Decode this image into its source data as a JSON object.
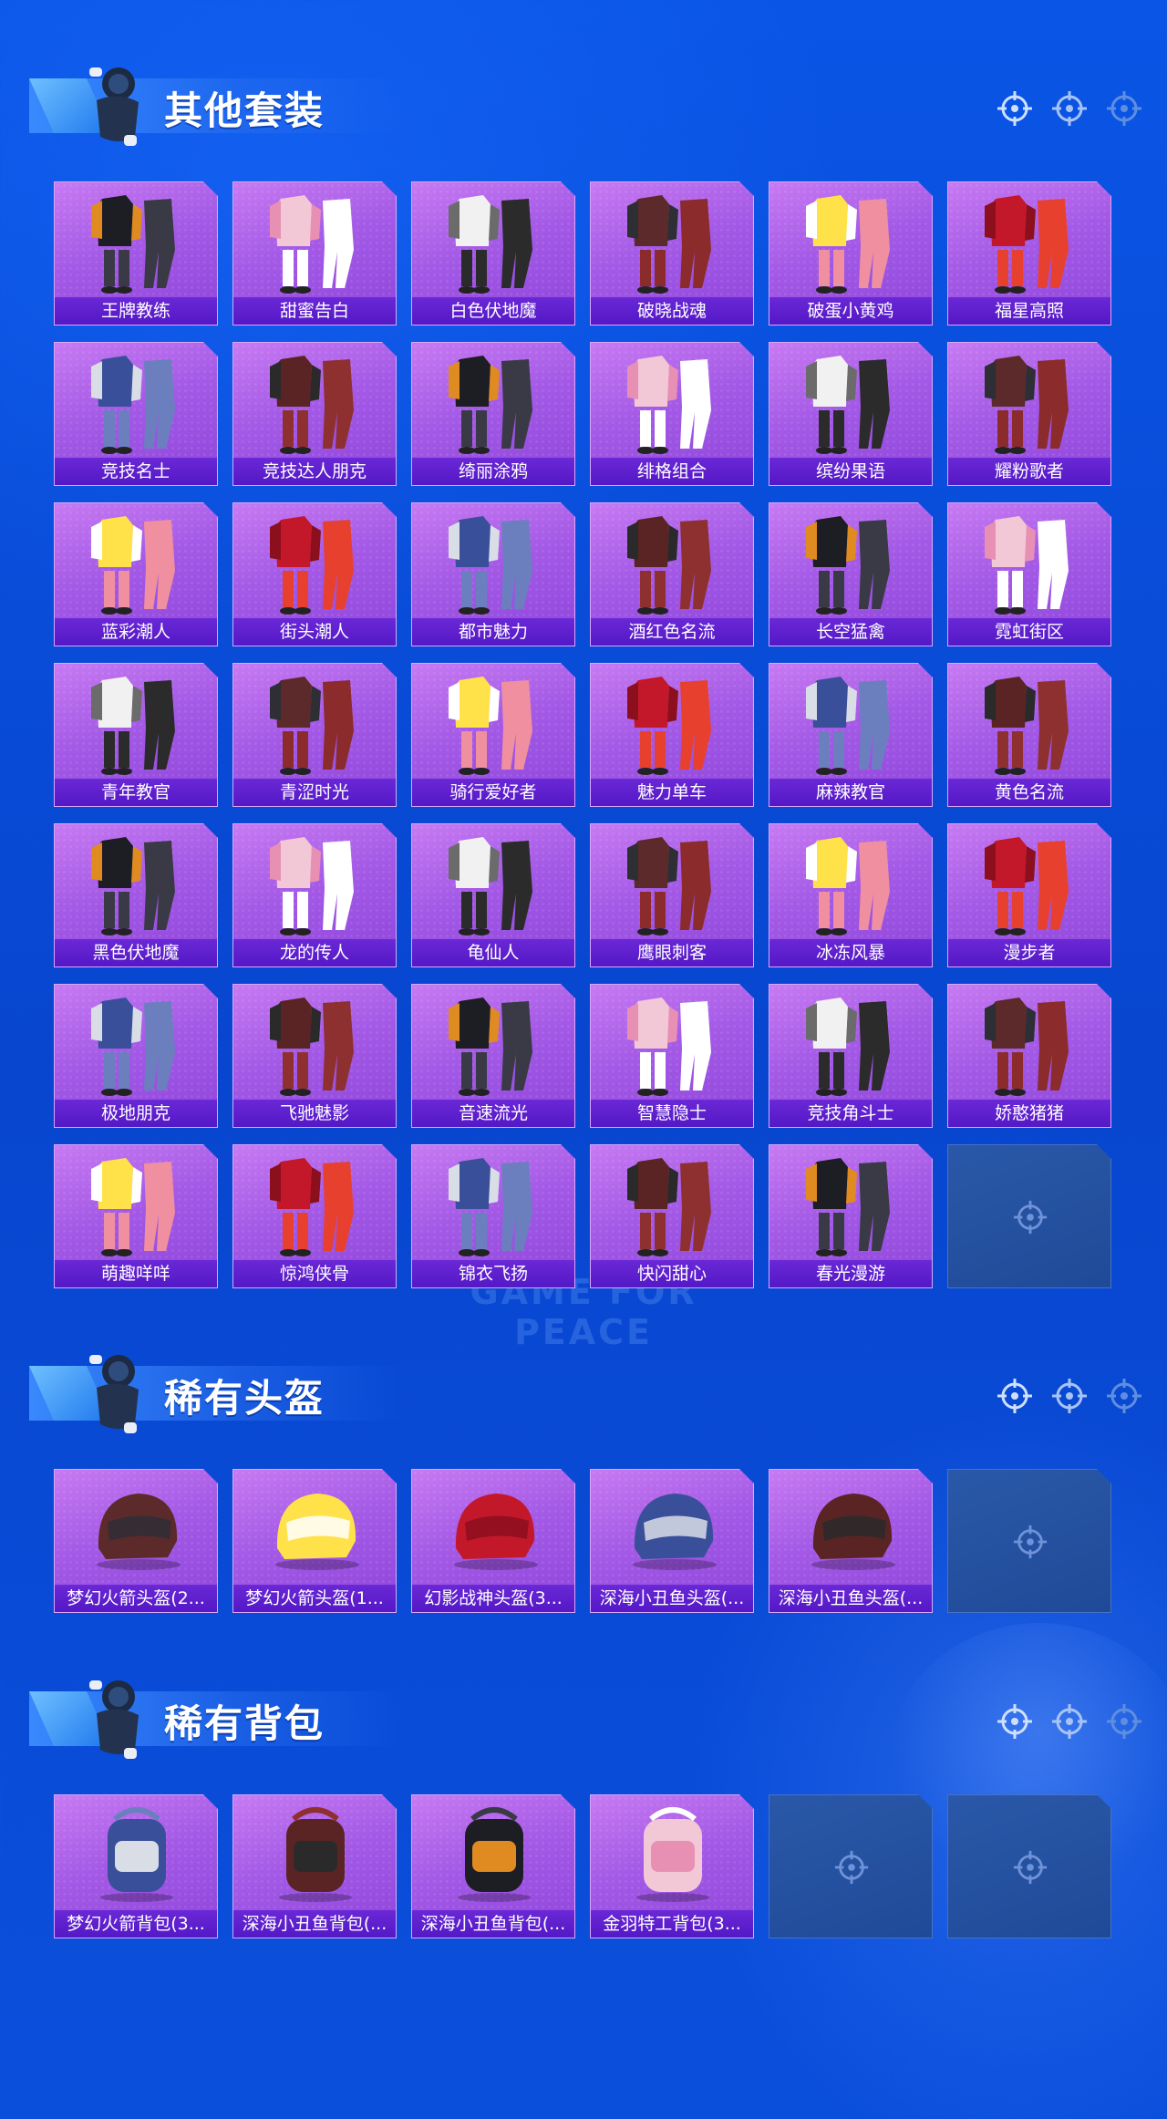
{
  "watermark": "GAME FOR PEACE",
  "sections": [
    {
      "title": "其他套装",
      "items": [
        "王牌教练",
        "甜蜜告白",
        "白色伏地魔",
        "破晓战魂",
        "破蛋小黄鸡",
        "福星高照",
        "竞技名士",
        "竞技达人朋克",
        "绮丽涂鸦",
        "绯格组合",
        "缤纷果语",
        "耀粉歌者",
        "蓝彩潮人",
        "街头潮人",
        "都市魅力",
        "酒红色名流",
        "长空猛禽",
        "霓虹街区",
        "青年教官",
        "青涩时光",
        "骑行爱好者",
        "魅力单车",
        "麻辣教官",
        "黄色名流",
        "黑色伏地魔",
        "龙的传人",
        "龟仙人",
        "鹰眼刺客",
        "冰冻风暴",
        "漫步者",
        "极地朋克",
        "飞驰魅影",
        "音速流光",
        "智慧隐士",
        "竞技角斗士",
        "娇憨猪猪",
        "萌趣咩咩",
        "惊鸿侠骨",
        "锦衣飞扬",
        "快闪甜心",
        "春光漫游"
      ]
    },
    {
      "title": "稀有头盔",
      "items": [
        "梦幻火箭头盔(2...",
        "梦幻火箭头盔(1...",
        "幻影战神头盔(3...",
        "深海小丑鱼头盔(...",
        "深海小丑鱼头盔(..."
      ]
    },
    {
      "title": "稀有背包",
      "items": [
        "梦幻火箭背包(3...",
        "深海小丑鱼背包(...",
        "深海小丑鱼背包(...",
        "金羽特工背包(3..."
      ]
    }
  ],
  "colors": {
    "card_top": "#c77af2",
    "card_label": "#5e1fcc",
    "empty_slot": "#254f9f",
    "background": "#0a4ad6"
  },
  "icons": {
    "placeholder": "crosshair-icon",
    "mascot": "mascot-icon"
  }
}
